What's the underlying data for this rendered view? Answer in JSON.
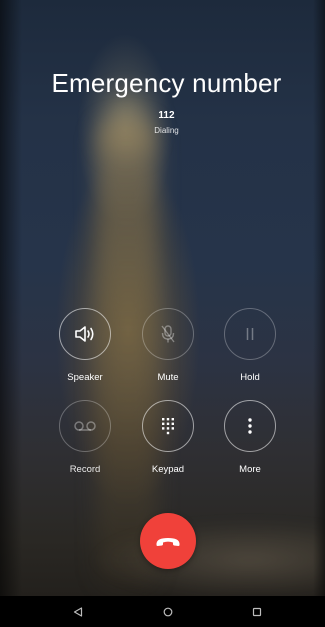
{
  "call": {
    "title": "Emergency number",
    "number": "112",
    "status": "Dialing"
  },
  "controls": {
    "speaker": {
      "label": "Speaker",
      "icon": "speaker-icon"
    },
    "mute": {
      "label": "Mute",
      "icon": "mic-off-icon"
    },
    "hold": {
      "label": "Hold",
      "icon": "pause-icon"
    },
    "record": {
      "label": "Record",
      "icon": "voicemail-icon"
    },
    "keypad": {
      "label": "Keypad",
      "icon": "dialpad-icon"
    },
    "more": {
      "label": "More",
      "icon": "more-vertical-icon"
    }
  },
  "end_call": {
    "icon": "hang-up-icon",
    "color": "#f0413a"
  },
  "navbar": {
    "back": "back-triangle-icon",
    "home": "home-circle-icon",
    "recents": "recents-square-icon"
  }
}
